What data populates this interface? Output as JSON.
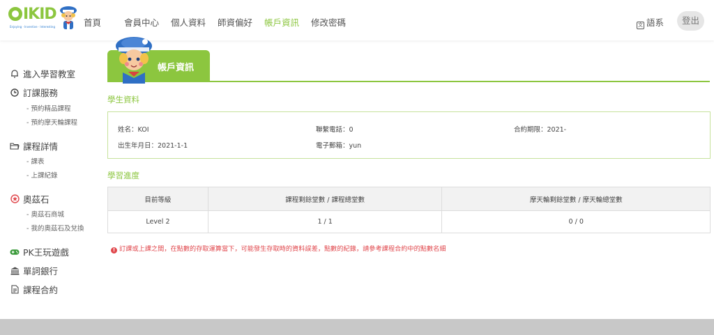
{
  "header": {
    "logo_text": "IKID",
    "logo_tagline": "Enjoying · Inventive · Interesting",
    "nav": [
      "首頁",
      "會員中心",
      "個人資料",
      "師資偏好",
      "帳戶資訊",
      "修改密碼"
    ],
    "active_nav": "帳戶資訊",
    "language_label": "語系",
    "logout_label": "登出"
  },
  "sidebar": {
    "sections": [
      {
        "label": "進入學習教室",
        "icon": "bell-icon"
      },
      {
        "label": "訂課服務",
        "icon": "clock-icon",
        "items": [
          "- 預約精品課程",
          "- 預約摩天輪課程"
        ]
      },
      {
        "label": "課程詳情",
        "icon": "folder-icon",
        "items": [
          "- 課表",
          "- 上課紀錄"
        ]
      },
      {
        "label": "奧茲石",
        "icon": "gem-icon",
        "items": [
          "- 奧茲石商城",
          "- 我的奧茲石及兌換"
        ]
      },
      {
        "label": "PK王玩遊戲",
        "icon": "gamepad-icon"
      },
      {
        "label": "單詞銀行",
        "icon": "bank-icon"
      },
      {
        "label": "課程合約",
        "icon": "document-icon"
      }
    ]
  },
  "page": {
    "title": "帳戶資訊",
    "student_section": "學生資料",
    "student": {
      "name": "姓名：KOI",
      "phone": "聯繫電話：0",
      "contract": "合約期限：2021-",
      "birthday": "出生年月日：2021-1-1",
      "email": "電子郵箱：yun"
    },
    "progress_section": "學習進度",
    "progress_table": {
      "headers": [
        "目前等級",
        "課程剩餘堂數 / 課程總堂數",
        "摩天輪剩餘堂數 / 摩天輪總堂數"
      ],
      "rows": [
        [
          "Level 2",
          "1 / 1",
          "0 / 0"
        ]
      ]
    },
    "warning": "訂課或上課之間，在點數的存取運算當下，可能發生存取時的資料誤差，點數的紀錄，請參考課程合約中的點數名細"
  },
  "colors": {
    "brand_green": "#8cc63f",
    "warning_red": "#e0474c",
    "light_border": "#c6e29c"
  }
}
